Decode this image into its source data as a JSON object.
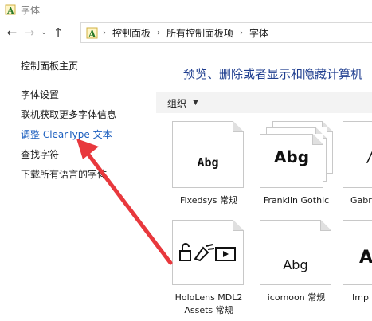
{
  "window": {
    "title": "字体"
  },
  "address": {
    "crumbs": [
      "控制面板",
      "所有控制面板项",
      "字体"
    ]
  },
  "sidebar": {
    "home": "控制面板主页",
    "tasks": [
      "字体设置",
      "联机获取更多字体信息",
      "调整 ClearType 文本",
      "查找字符",
      "下载所有语言的字体"
    ]
  },
  "main": {
    "heading": "预览、删除或者显示和隐藏计算机",
    "organize": "组织",
    "fonts": [
      {
        "name": "Fixedsys 常规",
        "sample": "Abg"
      },
      {
        "name": "Franklin Gothic",
        "sample": "Abg"
      },
      {
        "name": "Gabr",
        "sample": "/"
      },
      {
        "name_line1": "HoloLens MDL2",
        "name_line2": "Assets 常规"
      },
      {
        "name": "icomoon 常规",
        "sample": "Abg"
      },
      {
        "name": "Imp",
        "sample": "A"
      }
    ]
  },
  "colors": {
    "link": "#1c5fbf",
    "heading": "#1e3d8f",
    "annotation_arrow": "#e8383d"
  }
}
